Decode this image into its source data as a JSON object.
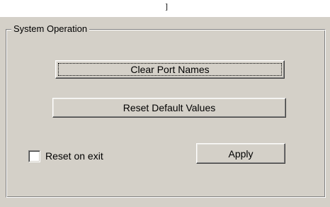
{
  "top_mark": "]",
  "group": {
    "title": "System Operation"
  },
  "buttons": {
    "clear_port_names": "Clear Port Names",
    "reset_default_values": "Reset Default Values",
    "apply": "Apply"
  },
  "reset_on_exit": {
    "label": "Reset on exit",
    "checked": false
  },
  "colors": {
    "face": "#d4d0c8",
    "shadow": "#808080",
    "highlight": "#ffffff"
  }
}
